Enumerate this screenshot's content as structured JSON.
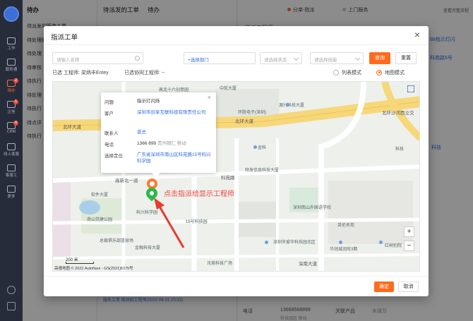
{
  "rail": {
    "items": [
      {
        "label": "工作"
      },
      {
        "label": "服务通"
      },
      {
        "label": "待办",
        "badge": "2"
      },
      {
        "label": "企信",
        "badge": "1"
      },
      {
        "label": "CRM",
        "badge": "6"
      },
      {
        "label": "线上客服"
      },
      {
        "label": "客服工"
      },
      {
        "label": "更多"
      }
    ]
  },
  "todo": {
    "title": "待办",
    "items": [
      "待派发的服务工单",
      "待处理的工单",
      "待处理",
      "待审核",
      "待执行",
      "待处理",
      "待执行",
      "待点评",
      "待执行"
    ]
  },
  "middle": {
    "tab": "待派发的工单",
    "filter": "待办",
    "bottom_link": "服务工单 指派给工程师(2022-06-21 20:32)"
  },
  "right": {
    "step1": "分单-指派",
    "step2": "上门服务",
    "link": "查看完整流程",
    "heading": "指派工程师",
    "contact_label": "电话",
    "contact_value": "13668568899",
    "product_label": "关联产品",
    "product_value": "未填写",
    "id_fragment": "88指示灯闪",
    "addr_fragment": "科苑路5号",
    "tech_label": "科技",
    "dept_fragment": "科技园区 移动"
  },
  "modal": {
    "title": "指派工单",
    "close_label": "×",
    "filters": {
      "name_placeholder": "请输入名称",
      "dept_label": "+选择部门",
      "status_placeholder": "请选择状态",
      "skill_placeholder": "请选择技能",
      "search_label": "查询",
      "reset_label": "重置"
    },
    "selected_text": "已选 工程师: 梁炳丰Entey",
    "synced_text": "已选协同工程师: --",
    "view_modes": {
      "list": "列表模式",
      "map": "地图模式",
      "selected": "map"
    },
    "ok_label": "确定",
    "cancel_label": "取消"
  },
  "popup": {
    "close_label": "×",
    "rows": [
      {
        "label": "问题",
        "value": "指示灯闪烁"
      },
      {
        "label": "客户",
        "value": "深圳市创享互联科技有限责任公司"
      },
      {
        "label": "联系人",
        "value": "曾总"
      },
      {
        "label": "电话",
        "value": "1366    899",
        "extra": "贵州铜仁 移动"
      },
      {
        "label": "选择定位",
        "value": "广东省深圳市南山区科苑路15号科兴科学园"
      }
    ]
  },
  "map": {
    "annotation": "点击指派给显示工程师",
    "zoom_in": "+",
    "zoom_out": "−",
    "scale": "200 米",
    "attribution": "高德地图 © 2022 AutoNavi - GS(2021)6375号",
    "labels": {
      "l1": "北环大道",
      "l2": "北环大道",
      "l3": "北环沙河西立交",
      "l4": "科兴科学园",
      "l5": "深圳南山外国语学校",
      "l6": "南山党建公园",
      "l7": "金融科技大厦",
      "l8": "讯美科技广场",
      "l9": "软件大厦",
      "l10": "深圳市爱华科技园北区",
      "l11": "华润城润府3期",
      "l12": "红树别院",
      "l13": "英伦名苑",
      "l14": "源兴科技大厦",
      "l15": "金科",
      "l16": "特发信息科技大厦",
      "l17": "环胜电子(深圳)",
      "l18": "高北十六创意园",
      "l19": "中航大厦",
      "l20": "16号科技园",
      "l21": "总裁俱乐部篮球场",
      "l22": "高新北一道",
      "l23": "科苑路",
      "l24": "深南大道",
      "l25": "科技"
    }
  }
}
